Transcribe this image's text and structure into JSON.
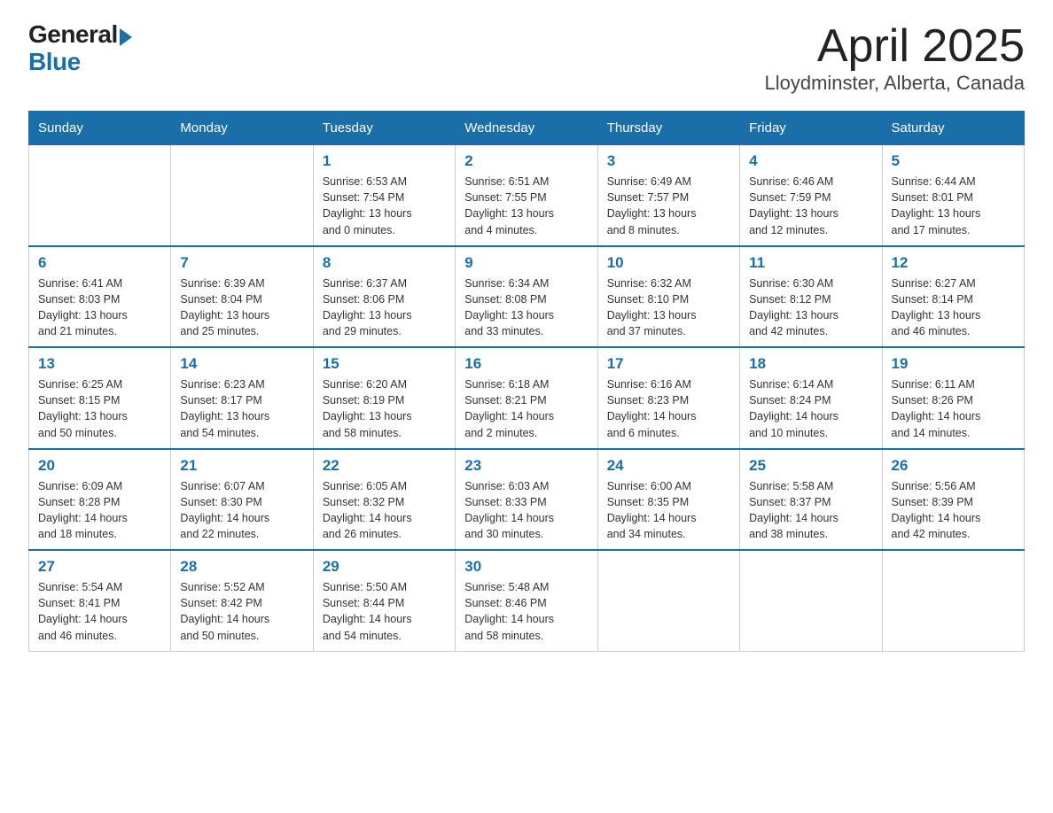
{
  "header": {
    "logo_general": "General",
    "logo_blue": "Blue",
    "title": "April 2025",
    "subtitle": "Lloydminster, Alberta, Canada"
  },
  "days_of_week": [
    "Sunday",
    "Monday",
    "Tuesday",
    "Wednesday",
    "Thursday",
    "Friday",
    "Saturday"
  ],
  "weeks": [
    [
      {
        "day": "",
        "info": ""
      },
      {
        "day": "",
        "info": ""
      },
      {
        "day": "1",
        "info": "Sunrise: 6:53 AM\nSunset: 7:54 PM\nDaylight: 13 hours\nand 0 minutes."
      },
      {
        "day": "2",
        "info": "Sunrise: 6:51 AM\nSunset: 7:55 PM\nDaylight: 13 hours\nand 4 minutes."
      },
      {
        "day": "3",
        "info": "Sunrise: 6:49 AM\nSunset: 7:57 PM\nDaylight: 13 hours\nand 8 minutes."
      },
      {
        "day": "4",
        "info": "Sunrise: 6:46 AM\nSunset: 7:59 PM\nDaylight: 13 hours\nand 12 minutes."
      },
      {
        "day": "5",
        "info": "Sunrise: 6:44 AM\nSunset: 8:01 PM\nDaylight: 13 hours\nand 17 minutes."
      }
    ],
    [
      {
        "day": "6",
        "info": "Sunrise: 6:41 AM\nSunset: 8:03 PM\nDaylight: 13 hours\nand 21 minutes."
      },
      {
        "day": "7",
        "info": "Sunrise: 6:39 AM\nSunset: 8:04 PM\nDaylight: 13 hours\nand 25 minutes."
      },
      {
        "day": "8",
        "info": "Sunrise: 6:37 AM\nSunset: 8:06 PM\nDaylight: 13 hours\nand 29 minutes."
      },
      {
        "day": "9",
        "info": "Sunrise: 6:34 AM\nSunset: 8:08 PM\nDaylight: 13 hours\nand 33 minutes."
      },
      {
        "day": "10",
        "info": "Sunrise: 6:32 AM\nSunset: 8:10 PM\nDaylight: 13 hours\nand 37 minutes."
      },
      {
        "day": "11",
        "info": "Sunrise: 6:30 AM\nSunset: 8:12 PM\nDaylight: 13 hours\nand 42 minutes."
      },
      {
        "day": "12",
        "info": "Sunrise: 6:27 AM\nSunset: 8:14 PM\nDaylight: 13 hours\nand 46 minutes."
      }
    ],
    [
      {
        "day": "13",
        "info": "Sunrise: 6:25 AM\nSunset: 8:15 PM\nDaylight: 13 hours\nand 50 minutes."
      },
      {
        "day": "14",
        "info": "Sunrise: 6:23 AM\nSunset: 8:17 PM\nDaylight: 13 hours\nand 54 minutes."
      },
      {
        "day": "15",
        "info": "Sunrise: 6:20 AM\nSunset: 8:19 PM\nDaylight: 13 hours\nand 58 minutes."
      },
      {
        "day": "16",
        "info": "Sunrise: 6:18 AM\nSunset: 8:21 PM\nDaylight: 14 hours\nand 2 minutes."
      },
      {
        "day": "17",
        "info": "Sunrise: 6:16 AM\nSunset: 8:23 PM\nDaylight: 14 hours\nand 6 minutes."
      },
      {
        "day": "18",
        "info": "Sunrise: 6:14 AM\nSunset: 8:24 PM\nDaylight: 14 hours\nand 10 minutes."
      },
      {
        "day": "19",
        "info": "Sunrise: 6:11 AM\nSunset: 8:26 PM\nDaylight: 14 hours\nand 14 minutes."
      }
    ],
    [
      {
        "day": "20",
        "info": "Sunrise: 6:09 AM\nSunset: 8:28 PM\nDaylight: 14 hours\nand 18 minutes."
      },
      {
        "day": "21",
        "info": "Sunrise: 6:07 AM\nSunset: 8:30 PM\nDaylight: 14 hours\nand 22 minutes."
      },
      {
        "day": "22",
        "info": "Sunrise: 6:05 AM\nSunset: 8:32 PM\nDaylight: 14 hours\nand 26 minutes."
      },
      {
        "day": "23",
        "info": "Sunrise: 6:03 AM\nSunset: 8:33 PM\nDaylight: 14 hours\nand 30 minutes."
      },
      {
        "day": "24",
        "info": "Sunrise: 6:00 AM\nSunset: 8:35 PM\nDaylight: 14 hours\nand 34 minutes."
      },
      {
        "day": "25",
        "info": "Sunrise: 5:58 AM\nSunset: 8:37 PM\nDaylight: 14 hours\nand 38 minutes."
      },
      {
        "day": "26",
        "info": "Sunrise: 5:56 AM\nSunset: 8:39 PM\nDaylight: 14 hours\nand 42 minutes."
      }
    ],
    [
      {
        "day": "27",
        "info": "Sunrise: 5:54 AM\nSunset: 8:41 PM\nDaylight: 14 hours\nand 46 minutes."
      },
      {
        "day": "28",
        "info": "Sunrise: 5:52 AM\nSunset: 8:42 PM\nDaylight: 14 hours\nand 50 minutes."
      },
      {
        "day": "29",
        "info": "Sunrise: 5:50 AM\nSunset: 8:44 PM\nDaylight: 14 hours\nand 54 minutes."
      },
      {
        "day": "30",
        "info": "Sunrise: 5:48 AM\nSunset: 8:46 PM\nDaylight: 14 hours\nand 58 minutes."
      },
      {
        "day": "",
        "info": ""
      },
      {
        "day": "",
        "info": ""
      },
      {
        "day": "",
        "info": ""
      }
    ]
  ]
}
